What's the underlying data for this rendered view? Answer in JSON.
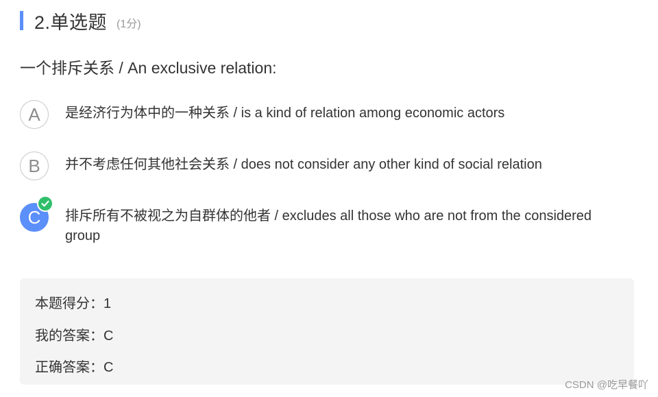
{
  "question": {
    "number_type": "2.单选题",
    "score_hint": "(1分)",
    "stem": "一个排斥关系 /  An exclusive relation:"
  },
  "options": [
    {
      "letter": "A",
      "text": "是经济行为体中的一种关系 / is a kind of relation among economic actors",
      "selected": false
    },
    {
      "letter": "B",
      "text": "并不考虑任何其他社会关系 / does not consider any other kind of social relation",
      "selected": false
    },
    {
      "letter": "C",
      "text": "排斥所有不被视之为自群体的他者 / excludes all those who are not from the considered group",
      "selected": true
    }
  ],
  "result": {
    "score_line": "本题得分：1",
    "my_answer_line": "我的答案：C",
    "correct_answer_line": "正确答案：C"
  },
  "watermark": "CSDN @吃早餐吖",
  "colors": {
    "accent": "#5b8ff9",
    "check": "#2fbf6b",
    "result_bg": "#f4f4f4"
  },
  "icons": {
    "selected_check": "check-icon"
  }
}
